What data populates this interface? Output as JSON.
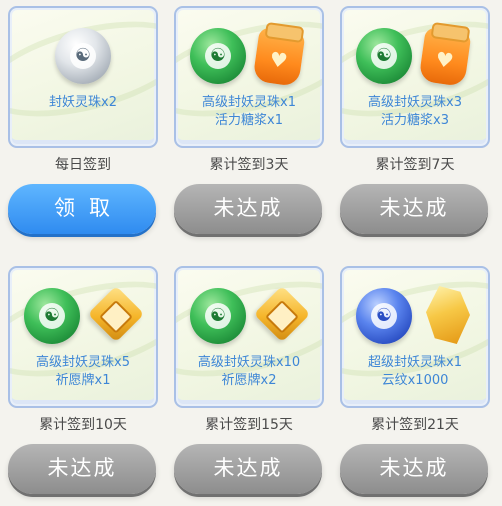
{
  "rewards": [
    {
      "items": [
        "封妖灵珠x2"
      ],
      "condition": "每日签到",
      "button": "领取",
      "state": "claimable",
      "icons": [
        "white-orb-icon"
      ]
    },
    {
      "items": [
        "高级封妖灵珠x1",
        "活力糖浆x1"
      ],
      "condition": "累计签到3天",
      "button": "未达成",
      "state": "locked",
      "icons": [
        "green-orb-icon",
        "orange-jar-icon"
      ]
    },
    {
      "items": [
        "高级封妖灵珠x3",
        "活力糖浆x3"
      ],
      "condition": "累计签到7天",
      "button": "未达成",
      "state": "locked",
      "icons": [
        "green-orb-icon",
        "orange-jar-icon"
      ]
    },
    {
      "items": [
        "高级封妖灵珠x5",
        "祈愿牌x1"
      ],
      "condition": "累计签到10天",
      "button": "未达成",
      "state": "locked",
      "icons": [
        "green-orb-icon",
        "wish-plaque-icon"
      ]
    },
    {
      "items": [
        "高级封妖灵珠x10",
        "祈愿牌x2"
      ],
      "condition": "累计签到15天",
      "button": "未达成",
      "state": "locked",
      "icons": [
        "green-orb-icon",
        "wish-plaque-icon"
      ]
    },
    {
      "items": [
        "超级封妖灵珠x1",
        "云纹x1000"
      ],
      "condition": "累计签到21天",
      "button": "未达成",
      "state": "locked",
      "icons": [
        "blue-orb-icon",
        "gold-cloud-pattern-icon"
      ]
    }
  ],
  "colors": {
    "reward_text": "#3d86d6",
    "claim_button": "#2f8bf0",
    "locked_button": "#8d8d8d",
    "card_border": "#a9c0e6"
  }
}
